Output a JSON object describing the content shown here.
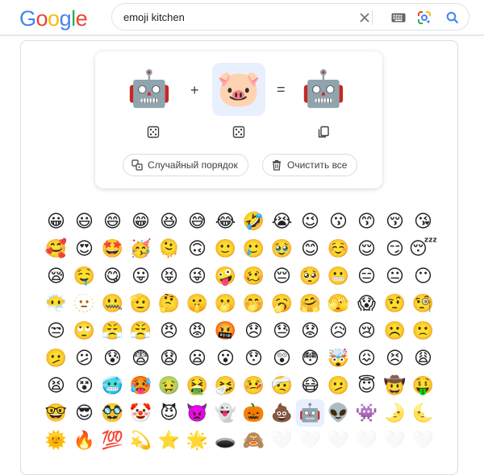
{
  "logo": {
    "letters": [
      "G",
      "o",
      "o",
      "g",
      "l",
      "e"
    ],
    "colors": [
      "#4285F4",
      "#EA4335",
      "#FBBC05",
      "#4285F4",
      "#34A853",
      "#EA4335"
    ]
  },
  "search": {
    "query": "emoji kitchen"
  },
  "icons": {
    "clear": "close-icon",
    "keyboard": "keyboard-icon",
    "lens": "google-lens-icon",
    "search": "search-icon"
  },
  "kitchen": {
    "left": "🤖",
    "right": "🐷",
    "result": "🤖",
    "plus": "+",
    "equals": "=",
    "shuffle_label": "Случайный порядок",
    "clear_label": "Очистить все"
  },
  "emoji_grid": [
    "😀",
    "😃",
    "😄",
    "😁",
    "😆",
    "😅",
    "😂",
    "🤣",
    "😭",
    "😉",
    "😗",
    "😙",
    "😚",
    "😘",
    "🥰",
    "😍",
    "🤩",
    "🥳",
    "🫠",
    "🙃",
    "🙂",
    "🥲",
    "🥹",
    "😊",
    "☺️",
    "😌",
    "😏",
    "😴",
    "😪",
    "🤤",
    "😋",
    "😛",
    "😝",
    "😜",
    "🤪",
    "🥴",
    "😔",
    "🥺",
    "😬",
    "😑",
    "😐",
    "😶",
    "😶‍🌫️",
    "🫥",
    "🤐",
    "🫡",
    "🤔",
    "🤫",
    "🫢",
    "🤭",
    "🥱",
    "🤗",
    "🫣",
    "😱",
    "🤨",
    "🧐",
    "😒",
    "🙄",
    "😤",
    "😤",
    "😠",
    "😡",
    "🤬",
    "😞",
    "😓",
    "😟",
    "😥",
    "😢",
    "☹️",
    "🙁",
    "🫤",
    "😕",
    "😰",
    "😨",
    "😧",
    "😦",
    "😮",
    "😯",
    "😲",
    "😳",
    "🤯",
    "😖",
    "😣",
    "😩",
    "😫",
    "😵",
    "🥶",
    "🥵",
    "🤢",
    "🤮",
    "🤧",
    "🤒",
    "🤕",
    "😷",
    "🫤",
    "😇",
    "🤠",
    "🤑",
    "🤓",
    "😎",
    "🥸",
    "🤡",
    "😈",
    "👿",
    "👻",
    "🎃",
    "💩",
    "🤖",
    "👽",
    "👾",
    "🌛",
    "🌜",
    "🌞",
    "🔥",
    "💯",
    "💫",
    "⭐",
    "🌟",
    "🕳️",
    "🙈",
    "🤍",
    "🤍",
    "🤍",
    "🤍",
    "🤍",
    "🤍"
  ],
  "active_index": 107,
  "dim_from": 120
}
